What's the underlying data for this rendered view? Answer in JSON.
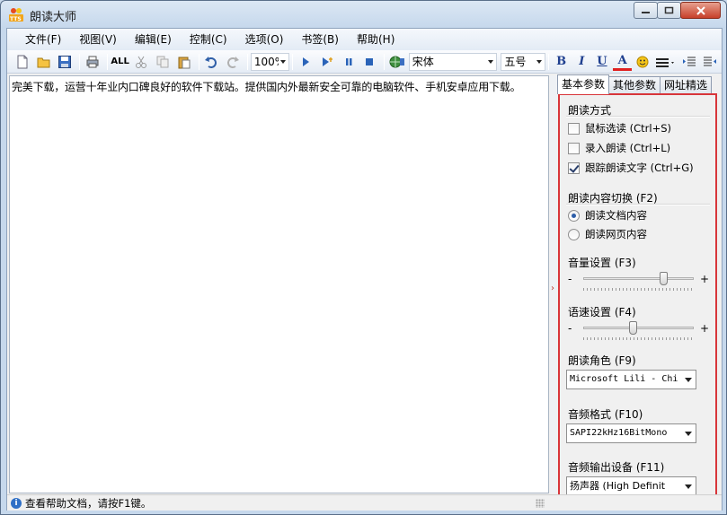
{
  "window": {
    "title": "朗读大师"
  },
  "menu": [
    "文件(F)",
    "视图(V)",
    "编辑(E)",
    "控制(C)",
    "选项(O)",
    "书签(B)",
    "帮助(H)"
  ],
  "toolbar": {
    "all_label": "ALL",
    "zoom": "100%",
    "font": "宋体",
    "font_size": "五号",
    "bold": "B",
    "italic": "I",
    "underline": "U",
    "font_color_letter": "A"
  },
  "editor": {
    "text": "完美下载，运营十年业内口碑良好的软件下载站。提供国内外最新安全可靠的电脑软件、手机安卓应用下载。"
  },
  "tabs": [
    {
      "label": "基本参数",
      "active": true
    },
    {
      "label": "其他参数",
      "active": false
    },
    {
      "label": "网址精选",
      "active": false
    }
  ],
  "panel": {
    "reading_mode": {
      "title": "朗读方式",
      "options": [
        {
          "label": "鼠标选读 (Ctrl+S)",
          "checked": false
        },
        {
          "label": "录入朗读 (Ctrl+L)",
          "checked": false
        },
        {
          "label": "跟踪朗读文字 (Ctrl+G)",
          "checked": true
        }
      ]
    },
    "content_switch": {
      "title": "朗读内容切换 (F2)",
      "options": [
        {
          "label": "朗读文档内容",
          "selected": true
        },
        {
          "label": "朗读网页内容",
          "selected": false
        }
      ]
    },
    "volume": {
      "title": "音量设置 (F3)",
      "minus": "-",
      "plus": "+",
      "level_fraction": 0.73
    },
    "speed": {
      "title": "语速设置 (F4)",
      "minus": "-",
      "plus": "+",
      "level_fraction": 0.45
    },
    "voice": {
      "title": "朗读角色 (F9)",
      "value": "Microsoft Lili - Chi"
    },
    "audio_format": {
      "title": "音频格式 (F10)",
      "value": "SAPI22kHz16BitMono"
    },
    "output_device": {
      "title": "音频输出设备 (F11)",
      "value": "扬声器 (High Definit"
    }
  },
  "status": {
    "icon": "i",
    "text": "查看帮助文档，请按F1键。"
  },
  "colors": {
    "accent_border": "#d8353a",
    "font_color": "#e02020"
  }
}
